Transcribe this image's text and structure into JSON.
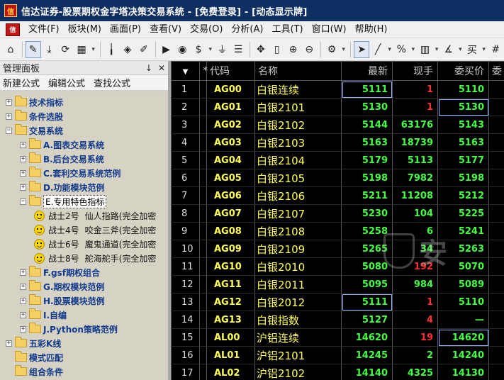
{
  "window": {
    "title": "信达证券-股票期权金字塔决策交易系统 - [免费登录] - [动态显示牌]"
  },
  "menu": [
    "文件(F)",
    "板块(M)",
    "画面(P)",
    "查看(V)",
    "交易(O)",
    "分析(A)",
    "工具(T)",
    "窗口(W)",
    "帮助(H)"
  ],
  "toolbar": {
    "icons": [
      "home-icon",
      "pencil-ruler-icon",
      "download-icon",
      "refresh-icon",
      "grid-icon",
      "candlestick-icon",
      "alert-icon",
      "edit-icon",
      "play-icon",
      "record-icon",
      "dollar-icon",
      "filter-icon",
      "bars-icon",
      "move-icon",
      "ruler-icon",
      "zoom-in-icon",
      "zoom-out-icon",
      "settings-icon",
      "cursor-icon",
      "line-icon",
      "percent-icon",
      "columns-icon",
      "angle-icon",
      "buy-sell-icon",
      "hash-icon"
    ]
  },
  "panel": {
    "title": "管理面板",
    "pin": "↓",
    "close": "✕",
    "actions": [
      "新建公式",
      "编辑公式",
      "查找公式"
    ],
    "tree": [
      {
        "label": "技术指标",
        "level": 0,
        "expander": "+",
        "folder": true
      },
      {
        "label": "条件选股",
        "level": 0,
        "expander": "+",
        "folder": true
      },
      {
        "label": "交易系统",
        "level": 0,
        "expander": "−",
        "folder": true
      },
      {
        "label": "A.图表交易系统",
        "level": 1,
        "expander": "+",
        "folder": true
      },
      {
        "label": "B.后台交易系统",
        "level": 1,
        "expander": "+",
        "folder": true
      },
      {
        "label": "C.套利交易系统范例",
        "level": 1,
        "expander": "+",
        "folder": true
      },
      {
        "label": "D.功能模块范例",
        "level": 1,
        "expander": "+",
        "folder": true
      },
      {
        "label": "E.专用特色指标",
        "level": 1,
        "expander": "−",
        "folder": true,
        "selected": true
      },
      {
        "label": "战士2号",
        "desc": "仙人指路(完全加密",
        "level": 2,
        "smile": true
      },
      {
        "label": "战士4号",
        "desc": "咬金三斧(完全加密",
        "level": 2,
        "smile": true
      },
      {
        "label": "战士6号",
        "desc": "魔鬼通道(完全加密",
        "level": 2,
        "smile": true
      },
      {
        "label": "战士8号",
        "desc": "舵海舵手(完全加密",
        "level": 2,
        "smile": true
      },
      {
        "label": "F.gsf期权组合",
        "level": 1,
        "expander": "+",
        "folder": true
      },
      {
        "label": "G.期权模块范例",
        "level": 1,
        "expander": "+",
        "folder": true
      },
      {
        "label": "H.股票模块范例",
        "level": 1,
        "expander": "+",
        "folder": true
      },
      {
        "label": "I.自编",
        "level": 1,
        "expander": "+",
        "folder": true
      },
      {
        "label": "J.Python策略范例",
        "level": 1,
        "expander": "+",
        "folder": true
      },
      {
        "label": "五彩K线",
        "level": 0,
        "expander": "+",
        "folder": true
      },
      {
        "label": "模式匹配",
        "level": 0,
        "folder": true
      },
      {
        "label": "组合条件",
        "level": 0,
        "folder": true
      }
    ]
  },
  "grid": {
    "sort_indicator": "▼",
    "columns": [
      "*",
      "代码",
      "名称",
      "最新",
      "现手",
      "委买价",
      "委"
    ],
    "rows": [
      {
        "no": "1",
        "code": "AG00",
        "name": "白银连续",
        "last": "5111",
        "vol": "1",
        "bid": "5110",
        "last_c": "up",
        "vol_c": "dn",
        "bid_c": "up",
        "hl": "last"
      },
      {
        "no": "2",
        "code": "AG01",
        "name": "白银2101",
        "last": "5130",
        "vol": "1",
        "bid": "5130",
        "last_c": "up",
        "vol_c": "dn",
        "bid_c": "up",
        "hl": "bid"
      },
      {
        "no": "3",
        "code": "AG02",
        "name": "白银2102",
        "last": "5144",
        "vol": "63176",
        "bid": "5143",
        "last_c": "up",
        "vol_c": "up",
        "bid_c": "up"
      },
      {
        "no": "4",
        "code": "AG03",
        "name": "白银2103",
        "last": "5163",
        "vol": "18739",
        "bid": "5163",
        "last_c": "up",
        "vol_c": "up",
        "bid_c": "up"
      },
      {
        "no": "5",
        "code": "AG04",
        "name": "白银2104",
        "last": "5179",
        "vol": "5113",
        "bid": "5177",
        "last_c": "up",
        "vol_c": "up",
        "bid_c": "up"
      },
      {
        "no": "6",
        "code": "AG05",
        "name": "白银2105",
        "last": "5198",
        "vol": "7982",
        "bid": "5198",
        "last_c": "up",
        "vol_c": "up",
        "bid_c": "up"
      },
      {
        "no": "7",
        "code": "AG06",
        "name": "白银2106",
        "last": "5211",
        "vol": "11208",
        "bid": "5212",
        "last_c": "up",
        "vol_c": "up",
        "bid_c": "up"
      },
      {
        "no": "8",
        "code": "AG07",
        "name": "白银2107",
        "last": "5230",
        "vol": "104",
        "bid": "5225",
        "last_c": "up",
        "vol_c": "up",
        "bid_c": "up"
      },
      {
        "no": "9",
        "code": "AG08",
        "name": "白银2108",
        "last": "5258",
        "vol": "6",
        "bid": "5241",
        "last_c": "up",
        "vol_c": "up",
        "bid_c": "up"
      },
      {
        "no": "10",
        "code": "AG09",
        "name": "白银2109",
        "last": "5265",
        "vol": "34",
        "bid": "5263",
        "last_c": "up",
        "vol_c": "up",
        "bid_c": "up"
      },
      {
        "no": "11",
        "code": "AG10",
        "name": "白银2010",
        "last": "5080",
        "vol": "192",
        "bid": "5070",
        "last_c": "up",
        "vol_c": "dn",
        "bid_c": "up"
      },
      {
        "no": "12",
        "code": "AG11",
        "name": "白银2011",
        "last": "5095",
        "vol": "984",
        "bid": "5089",
        "last_c": "up",
        "vol_c": "up",
        "bid_c": "up"
      },
      {
        "no": "13",
        "code": "AG12",
        "name": "白银2012",
        "last": "5111",
        "vol": "1",
        "bid": "5110",
        "last_c": "up",
        "vol_c": "dn",
        "bid_c": "up",
        "hl": "last"
      },
      {
        "no": "14",
        "code": "AG13",
        "name": "白银指数",
        "last": "5127",
        "vol": "4",
        "bid": "—",
        "last_c": "up",
        "vol_c": "dn",
        "bid_c": "up"
      },
      {
        "no": "15",
        "code": "AL00",
        "name": "沪铝连续",
        "last": "14620",
        "vol": "19",
        "bid": "14620",
        "last_c": "up",
        "vol_c": "dn",
        "bid_c": "up",
        "hl": "bid"
      },
      {
        "no": "16",
        "code": "AL01",
        "name": "沪铝2101",
        "last": "14245",
        "vol": "2",
        "bid": "14240",
        "last_c": "up",
        "vol_c": "up",
        "bid_c": "up"
      },
      {
        "no": "17",
        "code": "AL02",
        "name": "沪铝2102",
        "last": "14140",
        "vol": "4325",
        "bid": "14130",
        "last_c": "up",
        "vol_c": "up",
        "bid_c": "up"
      }
    ]
  },
  "colors": {
    "up": "#44ff44",
    "down": "#ff3030",
    "code": "#ffff55",
    "title_bg": "#0f2f62"
  }
}
